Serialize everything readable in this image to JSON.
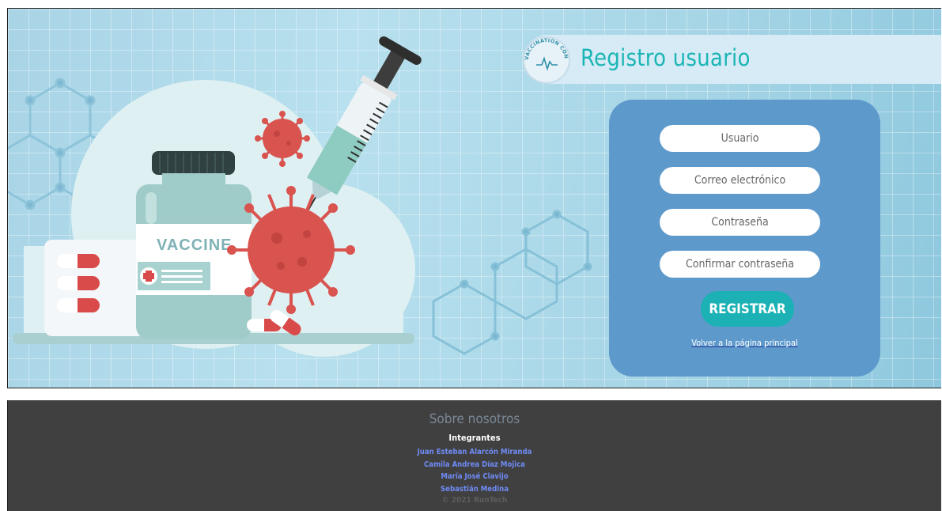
{
  "header": {
    "title": "Registro usuario",
    "logo_text": "VACCINATION CONTROL SYSTEM"
  },
  "illustration": {
    "vaccine_label": "VACCINE"
  },
  "form": {
    "username_placeholder": "Usuario",
    "email_placeholder": "Correo electrónico",
    "password_placeholder": "Contraseña",
    "confirm_password_placeholder": "Confirmar contraseña",
    "submit_label": "REGISTRAR",
    "back_link_label": "Volver a la página principal"
  },
  "footer": {
    "title": "Sobre nosotros",
    "subtitle": "Integrantes",
    "members": [
      "Juan Esteban Alarcón Miranda",
      "Camila Andrea Díaz Mojica",
      "María José Clavijo",
      "Sebastián Medina"
    ],
    "copyright": "© 2021 RunTech"
  },
  "colors": {
    "accent": "#1bb5b5",
    "panel": "#5e99cb",
    "title_band": "#d6ebf6",
    "footer_bg": "#404040",
    "member_link": "#6f8bf5",
    "virus": "#d9534f"
  }
}
